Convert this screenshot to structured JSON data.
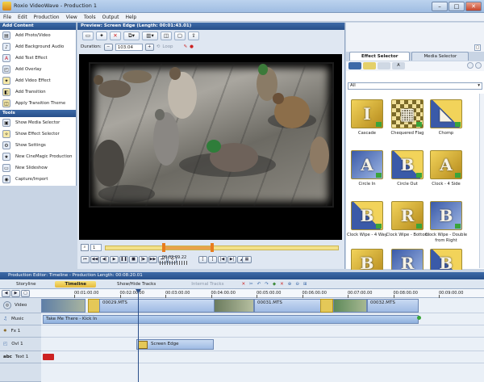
{
  "window": {
    "title": "Roxio VideoWave - Production 1"
  },
  "menu": [
    "File",
    "Edit",
    "Production",
    "View",
    "Tools",
    "Output",
    "Help"
  ],
  "add_content": {
    "title": "Add Content",
    "items": [
      "Add Photo/Video",
      "Add Background Audio",
      "Add Text Effect",
      "Add Overlay",
      "Add Video Effect",
      "Add Transition",
      "Apply Transition Theme"
    ]
  },
  "tools": {
    "title": "Tools",
    "items": [
      "Show Media Selector",
      "Show Effect Selector",
      "Show Settings",
      "New CineMagic Production",
      "New Slideshow",
      "Capture/Import"
    ]
  },
  "preview": {
    "title": "Preview: Screen Edge (Length: 00:01:43.01)",
    "duration_label": "Duration:",
    "duration_value": "103.04",
    "loop_label": "Loop",
    "frame_value": "1",
    "timecode": "00:02:09.22"
  },
  "effects": {
    "tabs": [
      "Effect Selector",
      "Media Selector"
    ],
    "filter": "All",
    "items": [
      {
        "label": "Cascade",
        "glyph": "I"
      },
      {
        "label": "Chequered Flag",
        "glyph": "▦"
      },
      {
        "label": "Chomp",
        "glyph": "◣"
      },
      {
        "label": "Circle In",
        "glyph": "A"
      },
      {
        "label": "Circle Out",
        "glyph": "B"
      },
      {
        "label": "Clock - 4 Side",
        "glyph": "A"
      },
      {
        "label": "Clock Wipe - 4 Way",
        "glyph": "B"
      },
      {
        "label": "Clock Wipe - Bottom",
        "glyph": "R"
      },
      {
        "label": "Clock Wipe - Double from Right",
        "glyph": "B"
      },
      {
        "label": "",
        "glyph": "B"
      },
      {
        "label": "",
        "glyph": "R"
      },
      {
        "label": "",
        "glyph": "B"
      }
    ]
  },
  "production": {
    "title": "Production Editor: Timeline - Production Length: 00:08:20.01",
    "storyline_tab": "Storyline",
    "timeline_tab": "Timeline",
    "show_hide": "Show/Hide Tracks",
    "internal_tracks": "Internal Tracks"
  },
  "ruler": [
    "00:01:00.00",
    "00:02:00.00",
    "00:03:00.00",
    "00:04:00.00",
    "00:05:00.00",
    "00:06:00.00",
    "00:07:00.00",
    "00:08:00.00",
    "00:09:00.00"
  ],
  "tracks": {
    "video": "Video",
    "music": "Music",
    "fx": "Fx 1",
    "ovl": "Ovl 1",
    "text": "Text 1"
  },
  "clips": {
    "video": [
      "00029.MTS",
      "00031.MTS",
      "00032.MTS"
    ],
    "music": "Take Me There - Kick In",
    "overlay": "Screen Edge",
    "text_badge": "abc"
  }
}
